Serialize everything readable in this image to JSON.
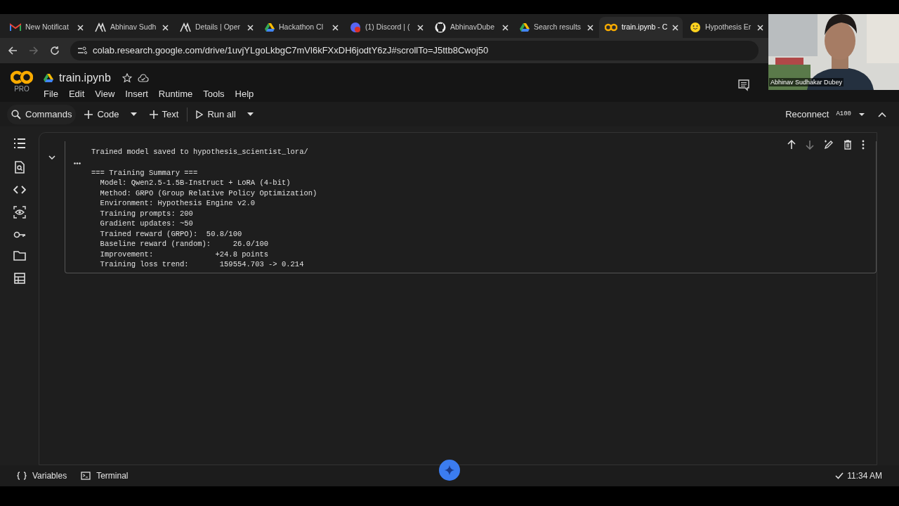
{
  "browser": {
    "tabs": [
      {
        "label": "New Notificat",
        "kind": "gmail",
        "selected": false
      },
      {
        "label": "Abhinav Sudh",
        "kind": "delta",
        "selected": false
      },
      {
        "label": "Details | Oper",
        "kind": "delta",
        "selected": false
      },
      {
        "label": "Hackathon Cl",
        "kind": "drive",
        "selected": false
      },
      {
        "label": "(1) Discord | (",
        "kind": "discord",
        "selected": false
      },
      {
        "label": "AbhinavDube",
        "kind": "github",
        "selected": false
      },
      {
        "label": "Search results",
        "kind": "drive",
        "selected": false
      },
      {
        "label": "train.ipynb - C",
        "kind": "colab",
        "selected": true
      },
      {
        "label": "Hypothesis Er",
        "kind": "hug",
        "selected": false
      }
    ],
    "url": "colab.research.google.com/drive/1uvjYLgoLkbgC7mVl6kFXxDH6jodtY6zJ#scrollTo=J5ttb8Cwoj50"
  },
  "video": {
    "kind": "picture",
    "caption": "Abhinav Sudhakar Dubey"
  },
  "notebook": {
    "logo_badge": "PRO",
    "title": "train.ipynb",
    "menu": [
      "File",
      "Edit",
      "View",
      "Insert",
      "Runtime",
      "Tools",
      "Help"
    ],
    "toolbar": [
      {
        "kind": "search",
        "label": "Commands"
      },
      {
        "kind": "add",
        "label": "Code",
        "dropdown": true
      },
      {
        "kind": "add",
        "label": "Text",
        "dropdown": false
      },
      {
        "kind": "run",
        "label": "Run all",
        "dropdown": true
      }
    ],
    "runtime": {
      "label": "Reconnect",
      "gpu": "A100"
    }
  },
  "cell": {
    "output": {
      "message": "Trained model saved to hypothesis_scientist_lora/",
      "summary": [
        "=== Training Summary ===",
        "  Model: Qwen2.5-1.5B-Instruct + LoRA (4-bit)",
        "  Method: GRPO (Group Relative Policy Optimization)",
        "  Environment: Hypothesis Engine v2.0",
        "  Training prompts: 200",
        "  Gradient updates: ~50",
        "  Trained reward (GRPO):  50.8/100",
        "  Baseline reward (random):     26.0/100",
        "  Improvement:              +24.8 points",
        "  Training loss trend:       159554.703 -> 0.214"
      ]
    }
  },
  "status_bar": {
    "items": [
      {
        "kind": "variables",
        "label": "Variables"
      },
      {
        "kind": "terminal",
        "label": "Terminal"
      }
    ],
    "time": "11:34 AM"
  }
}
